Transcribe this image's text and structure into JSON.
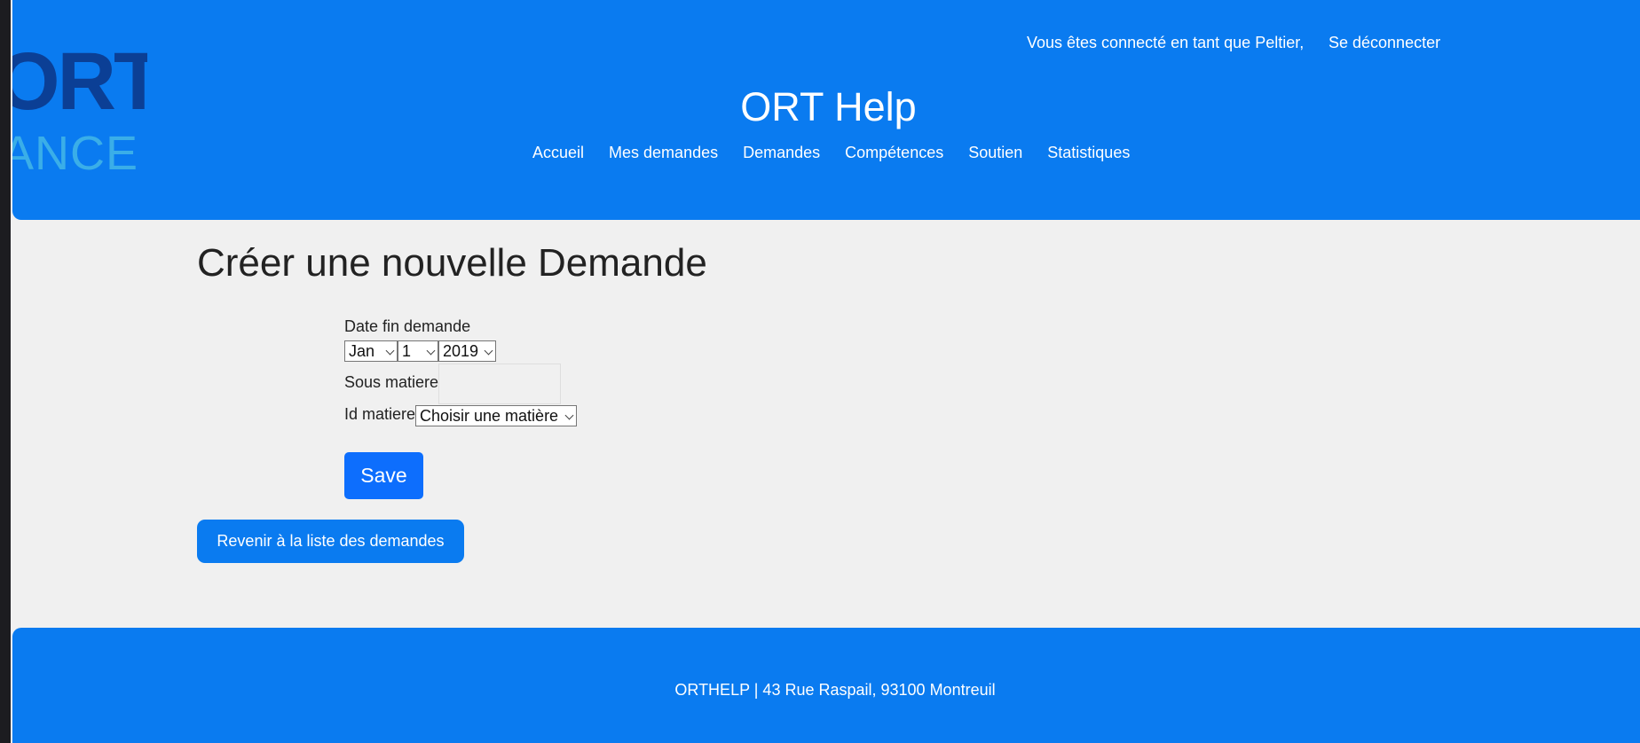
{
  "header": {
    "logo": {
      "top_text": "ORT",
      "bottom_text": "ANCE"
    },
    "user_status": "Vous êtes connecté en tant que Peltier,",
    "logout_label": "Se déconnecter",
    "site_title": "ORT Help",
    "nav": [
      {
        "label": "Accueil"
      },
      {
        "label": "Mes demandes"
      },
      {
        "label": "Demandes"
      },
      {
        "label": "Compétences"
      },
      {
        "label": "Soutien"
      },
      {
        "label": "Statistiques"
      }
    ]
  },
  "main": {
    "title": "Créer une nouvelle Demande",
    "form": {
      "date_label": "Date fin demande",
      "date_month": "Jan",
      "date_day": "1",
      "date_year": "2019",
      "sous_matiere_label": "Sous matiere",
      "sous_matiere_value": "",
      "id_matiere_label": "Id matiere",
      "id_matiere_selected": "Choisir une matière",
      "save_label": "Save"
    },
    "back_label": "Revenir à la liste des demandes"
  },
  "footer": {
    "text": "ORTHELP | 43 Rue Raspail, 93100 Montreuil"
  },
  "colors": {
    "primary": "#0a7bf0",
    "button": "#0d6efd",
    "background": "#f0f0f0",
    "logo_dark": "#0b3f95",
    "logo_light": "#3aaee8"
  }
}
